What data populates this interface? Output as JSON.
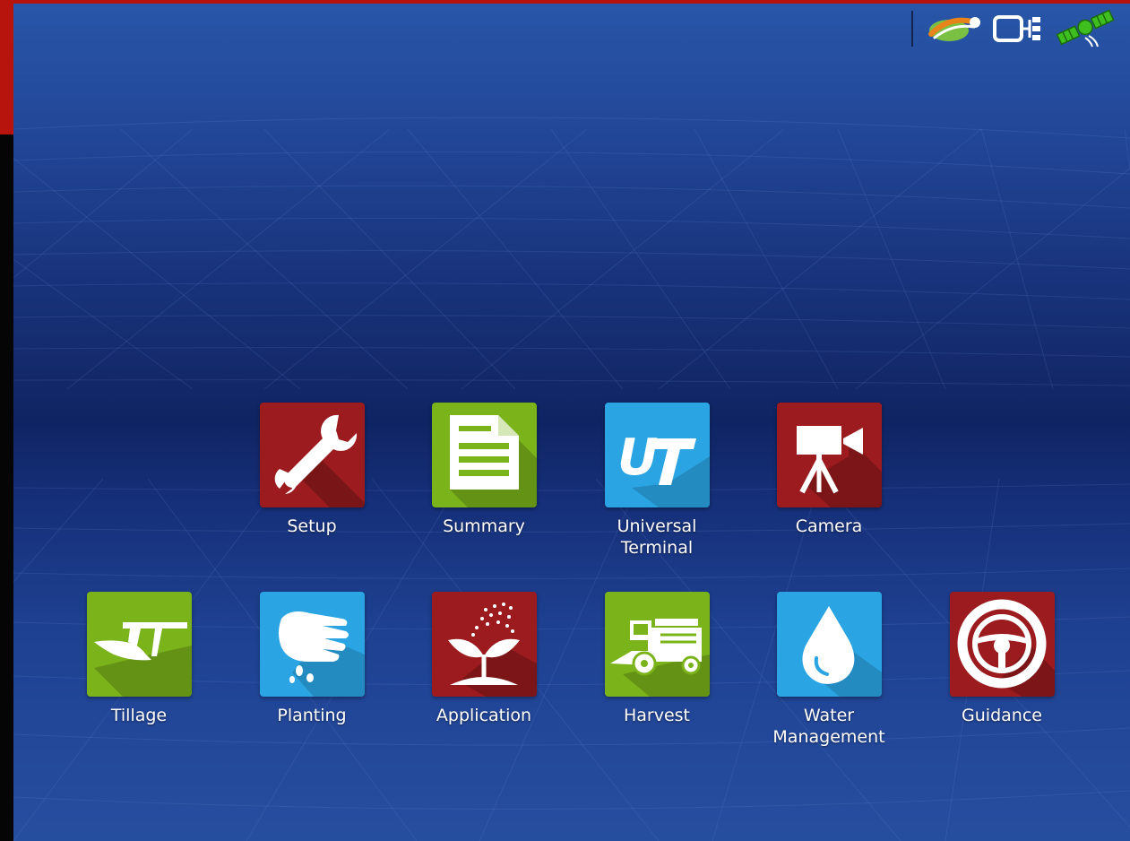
{
  "colors": {
    "frame_red": "#b8140e",
    "tile_red": "#9c1b1e",
    "tile_green": "#7bb31a",
    "tile_blue": "#2aa4e2",
    "background_blue": "#1a3680"
  },
  "status_bar": {
    "icons": [
      "field-logo-icon",
      "network-icon",
      "gps-satellite-icon"
    ]
  },
  "apps": {
    "setup": {
      "label": "Setup",
      "icon": "wrench-icon",
      "color": "red"
    },
    "summary": {
      "label": "Summary",
      "icon": "document-icon",
      "color": "green"
    },
    "universal_terminal": {
      "label": "Universal\nTerminal",
      "icon": "ut-icon",
      "color": "blue"
    },
    "camera": {
      "label": "Camera",
      "icon": "camera-icon",
      "color": "red"
    },
    "tillage": {
      "label": "Tillage",
      "icon": "plow-icon",
      "color": "green"
    },
    "planting": {
      "label": "Planting",
      "icon": "hand-seed-icon",
      "color": "blue"
    },
    "application": {
      "label": "Application",
      "icon": "sprout-spray-icon",
      "color": "red"
    },
    "harvest": {
      "label": "Harvest",
      "icon": "combine-icon",
      "color": "green"
    },
    "water_management": {
      "label": "Water\nManagement",
      "icon": "water-drop-icon",
      "color": "blue"
    },
    "guidance": {
      "label": "Guidance",
      "icon": "steering-wheel-icon",
      "color": "red"
    }
  }
}
